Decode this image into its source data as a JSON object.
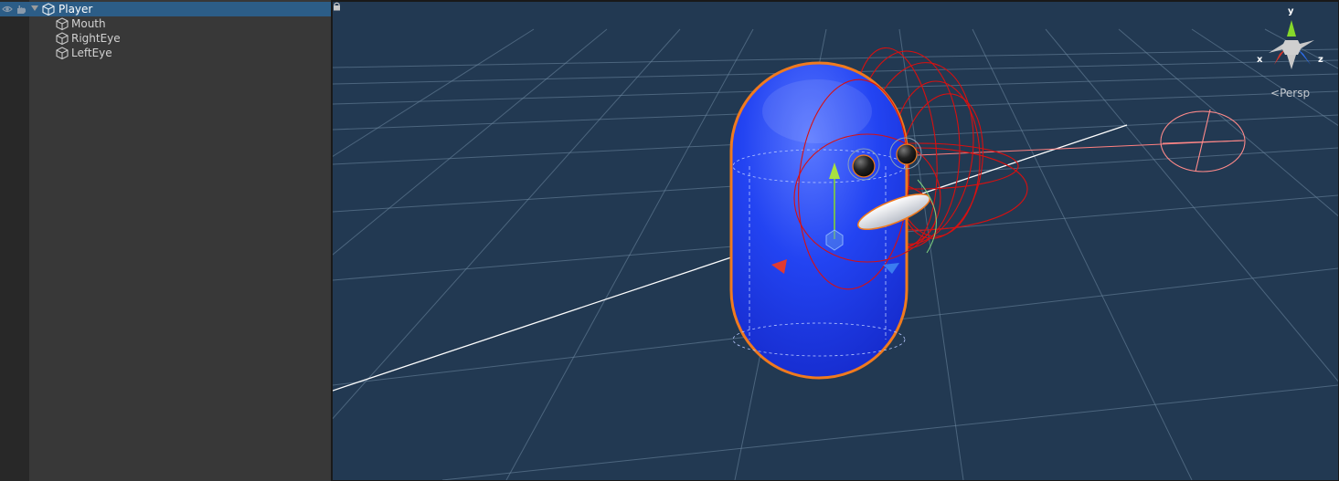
{
  "hierarchy": {
    "items": [
      {
        "label": "Player",
        "selected": true,
        "expanded": true,
        "depth": 0
      },
      {
        "label": "Mouth",
        "selected": false,
        "depth": 1
      },
      {
        "label": "RightEye",
        "selected": false,
        "depth": 1
      },
      {
        "label": "LeftEye",
        "selected": false,
        "depth": 1
      }
    ]
  },
  "scene": {
    "projection_label": "Persp",
    "gizmo": {
      "x_label": "x",
      "y_label": "y",
      "z_label": "z"
    },
    "colors": {
      "background": "#223952",
      "capsule": "#1f3cf0",
      "selection_outline": "#f07a1e",
      "light_gizmo": "#d81010",
      "axis_x": "#d8352a",
      "axis_y": "#86d92a",
      "axis_z": "#2d6ff0"
    }
  }
}
